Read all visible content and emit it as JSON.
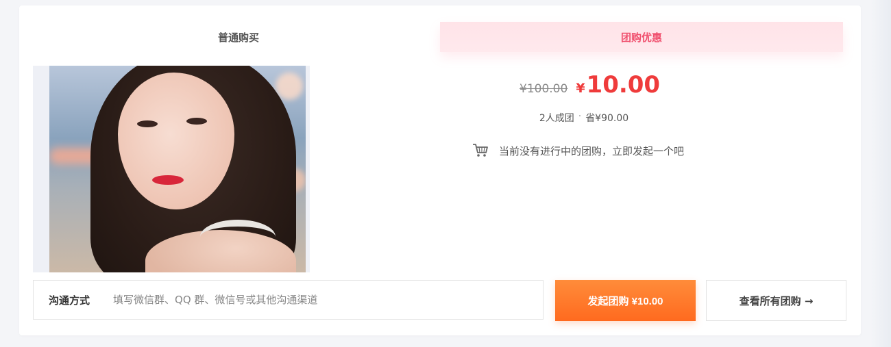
{
  "tabs": {
    "normal_label": "普通购买",
    "group_label": "团购优惠"
  },
  "price": {
    "original": "¥100.00",
    "currency_symbol": "¥",
    "current": "10.00"
  },
  "group_info": {
    "members": "2人成团",
    "separator": "·",
    "saving": "省¥90.00"
  },
  "status": {
    "icon": "cart-icon",
    "message": "当前没有进行中的团购，立即发起一个吧"
  },
  "contact": {
    "label": "沟通方式",
    "placeholder": "填写微信群、QQ 群、微信号或其他沟通渠道",
    "value": ""
  },
  "actions": {
    "launch_label": "发起团购 ¥10.00",
    "view_all_label": "查看所有团购 →"
  },
  "colors": {
    "accent": "#ef3b3b",
    "tab_active": "#f0506e",
    "button_orange": "#ff7a2a"
  }
}
